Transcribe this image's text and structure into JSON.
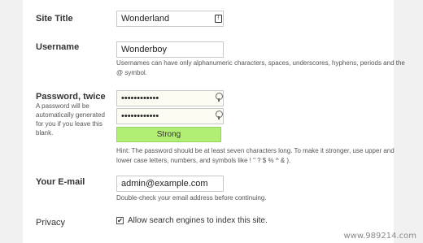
{
  "site_title": {
    "label": "Site Title",
    "value": "Wonderland",
    "icon": "info-card-icon"
  },
  "username": {
    "label": "Username",
    "value": "Wonderboy",
    "hint_line1": "Usernames can have only alphanumeric characters, spaces, underscores, hyphens, periods and the",
    "hint_line2": "@ symbol."
  },
  "password": {
    "label": "Password, twice",
    "subtext_line1": "A password will be",
    "subtext_line2": "automatically generated",
    "subtext_line3": "for you if you leave this",
    "subtext_line4": "blank.",
    "value1": "••••••••••••",
    "value2": "••••••••••••",
    "icon": "key-icon",
    "strength_label": "Strong",
    "strength_color": "#b3ee74",
    "hint_line1": "Hint: The password should be at least seven characters long. To make it stronger, use upper and",
    "hint_line2": "lower case letters, numbers, and symbols like ! \" ? $ % ^ & )."
  },
  "email": {
    "label": "Your E-mail",
    "value": "admin@example.com",
    "hint": "Double-check your email address before continuing."
  },
  "privacy": {
    "label": "Privacy",
    "checkbox_label": "Allow search engines to index this site.",
    "checked": true
  },
  "watermark": "www.989214.com"
}
